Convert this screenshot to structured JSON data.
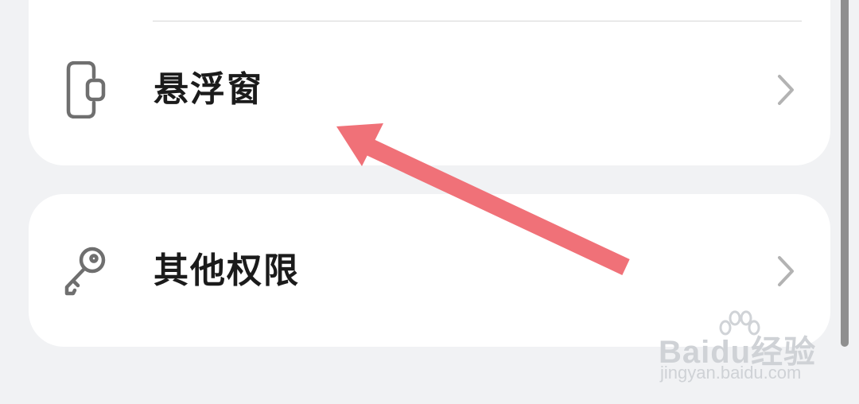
{
  "settings": {
    "items": [
      {
        "label": "悬浮窗",
        "icon": "floating-window-icon"
      },
      {
        "label": "其他权限",
        "icon": "key-icon"
      }
    ],
    "chevron_icon": "chevron-right-icon"
  },
  "annotation": {
    "arrow_color": "#f07178"
  },
  "watermark": {
    "main": "Baidu经验",
    "sub": "jingyan.baidu.com"
  },
  "colors": {
    "background": "#f1f2f4",
    "card": "#ffffff",
    "text": "#1b1b1b",
    "icon": "#6f6f6f",
    "chevron": "#b3b3b3"
  }
}
